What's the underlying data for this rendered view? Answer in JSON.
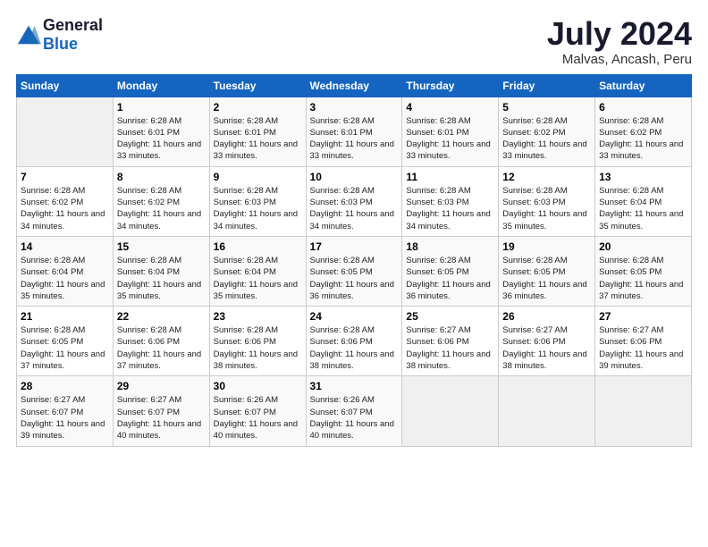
{
  "header": {
    "logo_general": "General",
    "logo_blue": "Blue",
    "month_year": "July 2024",
    "location": "Malvas, Ancash, Peru"
  },
  "days_of_week": [
    "Sunday",
    "Monday",
    "Tuesday",
    "Wednesday",
    "Thursday",
    "Friday",
    "Saturday"
  ],
  "weeks": [
    [
      {
        "day": "",
        "sunrise": "",
        "sunset": "",
        "daylight": ""
      },
      {
        "day": "1",
        "sunrise": "Sunrise: 6:28 AM",
        "sunset": "Sunset: 6:01 PM",
        "daylight": "Daylight: 11 hours and 33 minutes."
      },
      {
        "day": "2",
        "sunrise": "Sunrise: 6:28 AM",
        "sunset": "Sunset: 6:01 PM",
        "daylight": "Daylight: 11 hours and 33 minutes."
      },
      {
        "day": "3",
        "sunrise": "Sunrise: 6:28 AM",
        "sunset": "Sunset: 6:01 PM",
        "daylight": "Daylight: 11 hours and 33 minutes."
      },
      {
        "day": "4",
        "sunrise": "Sunrise: 6:28 AM",
        "sunset": "Sunset: 6:01 PM",
        "daylight": "Daylight: 11 hours and 33 minutes."
      },
      {
        "day": "5",
        "sunrise": "Sunrise: 6:28 AM",
        "sunset": "Sunset: 6:02 PM",
        "daylight": "Daylight: 11 hours and 33 minutes."
      },
      {
        "day": "6",
        "sunrise": "Sunrise: 6:28 AM",
        "sunset": "Sunset: 6:02 PM",
        "daylight": "Daylight: 11 hours and 33 minutes."
      }
    ],
    [
      {
        "day": "7",
        "sunrise": "Sunrise: 6:28 AM",
        "sunset": "Sunset: 6:02 PM",
        "daylight": "Daylight: 11 hours and 34 minutes."
      },
      {
        "day": "8",
        "sunrise": "Sunrise: 6:28 AM",
        "sunset": "Sunset: 6:02 PM",
        "daylight": "Daylight: 11 hours and 34 minutes."
      },
      {
        "day": "9",
        "sunrise": "Sunrise: 6:28 AM",
        "sunset": "Sunset: 6:03 PM",
        "daylight": "Daylight: 11 hours and 34 minutes."
      },
      {
        "day": "10",
        "sunrise": "Sunrise: 6:28 AM",
        "sunset": "Sunset: 6:03 PM",
        "daylight": "Daylight: 11 hours and 34 minutes."
      },
      {
        "day": "11",
        "sunrise": "Sunrise: 6:28 AM",
        "sunset": "Sunset: 6:03 PM",
        "daylight": "Daylight: 11 hours and 34 minutes."
      },
      {
        "day": "12",
        "sunrise": "Sunrise: 6:28 AM",
        "sunset": "Sunset: 6:03 PM",
        "daylight": "Daylight: 11 hours and 35 minutes."
      },
      {
        "day": "13",
        "sunrise": "Sunrise: 6:28 AM",
        "sunset": "Sunset: 6:04 PM",
        "daylight": "Daylight: 11 hours and 35 minutes."
      }
    ],
    [
      {
        "day": "14",
        "sunrise": "Sunrise: 6:28 AM",
        "sunset": "Sunset: 6:04 PM",
        "daylight": "Daylight: 11 hours and 35 minutes."
      },
      {
        "day": "15",
        "sunrise": "Sunrise: 6:28 AM",
        "sunset": "Sunset: 6:04 PM",
        "daylight": "Daylight: 11 hours and 35 minutes."
      },
      {
        "day": "16",
        "sunrise": "Sunrise: 6:28 AM",
        "sunset": "Sunset: 6:04 PM",
        "daylight": "Daylight: 11 hours and 35 minutes."
      },
      {
        "day": "17",
        "sunrise": "Sunrise: 6:28 AM",
        "sunset": "Sunset: 6:05 PM",
        "daylight": "Daylight: 11 hours and 36 minutes."
      },
      {
        "day": "18",
        "sunrise": "Sunrise: 6:28 AM",
        "sunset": "Sunset: 6:05 PM",
        "daylight": "Daylight: 11 hours and 36 minutes."
      },
      {
        "day": "19",
        "sunrise": "Sunrise: 6:28 AM",
        "sunset": "Sunset: 6:05 PM",
        "daylight": "Daylight: 11 hours and 36 minutes."
      },
      {
        "day": "20",
        "sunrise": "Sunrise: 6:28 AM",
        "sunset": "Sunset: 6:05 PM",
        "daylight": "Daylight: 11 hours and 37 minutes."
      }
    ],
    [
      {
        "day": "21",
        "sunrise": "Sunrise: 6:28 AM",
        "sunset": "Sunset: 6:05 PM",
        "daylight": "Daylight: 11 hours and 37 minutes."
      },
      {
        "day": "22",
        "sunrise": "Sunrise: 6:28 AM",
        "sunset": "Sunset: 6:06 PM",
        "daylight": "Daylight: 11 hours and 37 minutes."
      },
      {
        "day": "23",
        "sunrise": "Sunrise: 6:28 AM",
        "sunset": "Sunset: 6:06 PM",
        "daylight": "Daylight: 11 hours and 38 minutes."
      },
      {
        "day": "24",
        "sunrise": "Sunrise: 6:28 AM",
        "sunset": "Sunset: 6:06 PM",
        "daylight": "Daylight: 11 hours and 38 minutes."
      },
      {
        "day": "25",
        "sunrise": "Sunrise: 6:27 AM",
        "sunset": "Sunset: 6:06 PM",
        "daylight": "Daylight: 11 hours and 38 minutes."
      },
      {
        "day": "26",
        "sunrise": "Sunrise: 6:27 AM",
        "sunset": "Sunset: 6:06 PM",
        "daylight": "Daylight: 11 hours and 38 minutes."
      },
      {
        "day": "27",
        "sunrise": "Sunrise: 6:27 AM",
        "sunset": "Sunset: 6:06 PM",
        "daylight": "Daylight: 11 hours and 39 minutes."
      }
    ],
    [
      {
        "day": "28",
        "sunrise": "Sunrise: 6:27 AM",
        "sunset": "Sunset: 6:07 PM",
        "daylight": "Daylight: 11 hours and 39 minutes."
      },
      {
        "day": "29",
        "sunrise": "Sunrise: 6:27 AM",
        "sunset": "Sunset: 6:07 PM",
        "daylight": "Daylight: 11 hours and 40 minutes."
      },
      {
        "day": "30",
        "sunrise": "Sunrise: 6:26 AM",
        "sunset": "Sunset: 6:07 PM",
        "daylight": "Daylight: 11 hours and 40 minutes."
      },
      {
        "day": "31",
        "sunrise": "Sunrise: 6:26 AM",
        "sunset": "Sunset: 6:07 PM",
        "daylight": "Daylight: 11 hours and 40 minutes."
      },
      {
        "day": "",
        "sunrise": "",
        "sunset": "",
        "daylight": ""
      },
      {
        "day": "",
        "sunrise": "",
        "sunset": "",
        "daylight": ""
      },
      {
        "day": "",
        "sunrise": "",
        "sunset": "",
        "daylight": ""
      }
    ]
  ]
}
